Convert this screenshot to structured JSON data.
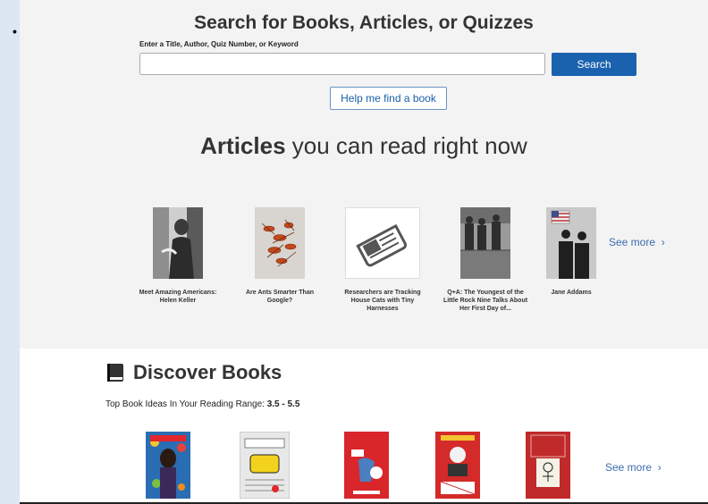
{
  "search": {
    "title": "Search for Books, Articles, or Quizzes",
    "label": "Enter a Title, Author, Quiz Number, or Keyword",
    "value": "",
    "button": "Search",
    "help_button": "Help me find a book"
  },
  "articles": {
    "heading_bold": "Articles",
    "heading_rest": " you can read right now",
    "items": [
      {
        "title": "Meet Amazing Americans: Helen Keller",
        "icon": "portrait-photo"
      },
      {
        "title": "Are Ants Smarter Than Google?",
        "icon": "ants-photo"
      },
      {
        "title": "Researchers are Tracking House Cats with Tiny Harnesses",
        "icon": "newspaper-icon"
      },
      {
        "title": "Q+A: The Youngest of the Little Rock Nine Talks About Her First Day of...",
        "icon": "historic-photo"
      },
      {
        "title": "Jane Addams",
        "icon": "historic-photo"
      }
    ],
    "see_more": "See more"
  },
  "discover": {
    "heading": "Discover Books",
    "range_label": "Top Book Ideas In Your Reading Range: ",
    "range_value": "3.5 - 5.5",
    "books": [
      {
        "icon": "book-cover",
        "color": "#2a6db3"
      },
      {
        "icon": "book-cover",
        "color": "#e8e8e8"
      },
      {
        "icon": "book-cover",
        "color": "#d9262b"
      },
      {
        "icon": "book-cover",
        "color": "#d42a2a"
      },
      {
        "icon": "book-cover",
        "color": "#c02a2a"
      }
    ],
    "see_more": "See more"
  },
  "colors": {
    "accent": "#1a62ae",
    "link": "#3c6cae",
    "background": "#f3f3f3"
  }
}
